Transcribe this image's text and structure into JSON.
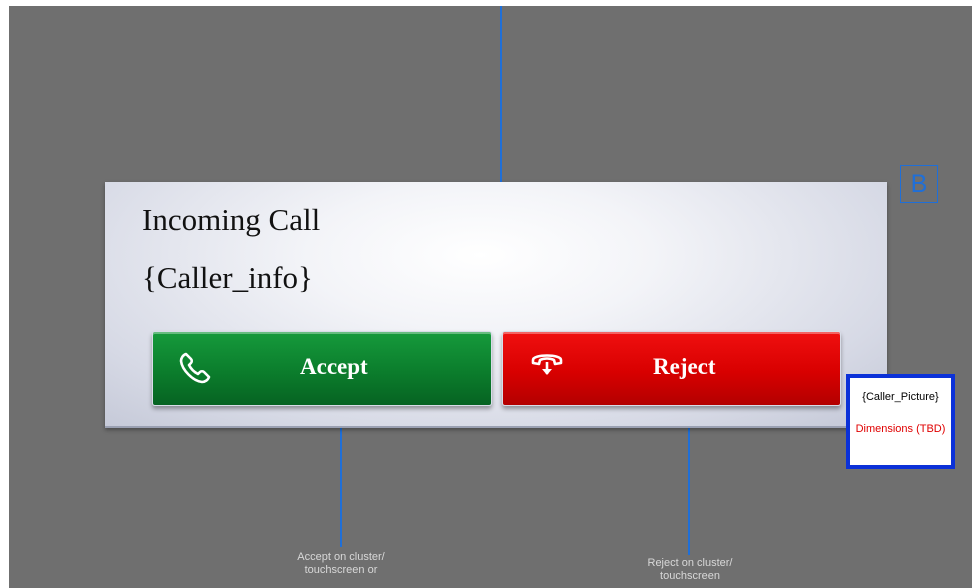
{
  "panel": {
    "title": "Incoming Call",
    "caller_info": "{Caller_info}"
  },
  "buttons": {
    "accept_label": "Accept",
    "accept_icon": "phone-icon",
    "reject_label": "Reject",
    "reject_icon": "hangup-icon"
  },
  "marker": {
    "label": "B"
  },
  "picture": {
    "label": "{Caller_Picture}",
    "dimensions": "Dimensions (TBD)"
  },
  "notes": {
    "accept": "Accept on cluster/\ntouchscreen or",
    "reject": "Reject on cluster/\ntouchscreen"
  },
  "colors": {
    "background": "#6f6f6f",
    "connector": "#1f6fd8",
    "accept": "#0b7d2c",
    "reject": "#d80000",
    "picture_border": "#0b31d8",
    "dimensions_text": "#e00000"
  }
}
